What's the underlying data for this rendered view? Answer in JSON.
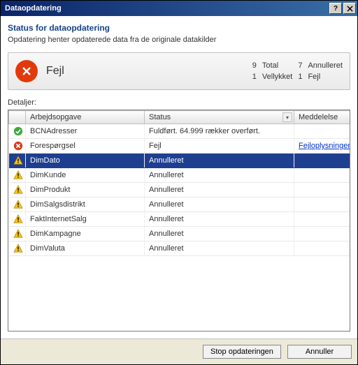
{
  "window": {
    "title": "Dataopdatering"
  },
  "header": {
    "title": "Status for dataopdatering",
    "subtitle": "Opdatering henter opdaterede data fra de originale datakilder"
  },
  "overall": {
    "status_text": "Fejl",
    "total_count": "9",
    "total_label": "Total",
    "cancelled_count": "7",
    "cancelled_label": "Annulleret",
    "success_count": "1",
    "success_label": "Vellykket",
    "error_count": "1",
    "error_label": "Fejl"
  },
  "details_label": "Detaljer:",
  "columns": {
    "icon": "",
    "work_item": "Arbejdsopgave",
    "status": "Status",
    "message": "Meddelelse"
  },
  "rows": [
    {
      "icon": "success",
      "name": "BCNAdresser",
      "status": "Fuldført. 64.999 rækker overført.",
      "message": "",
      "selected": false
    },
    {
      "icon": "error",
      "name": "Forespørgsel",
      "status": "Fejl",
      "message": "Fejloplysninger",
      "msg_link": true,
      "selected": false
    },
    {
      "icon": "warning",
      "name": "DimDato",
      "status": "Annulleret",
      "message": "",
      "selected": true
    },
    {
      "icon": "warning",
      "name": "DimKunde",
      "status": "Annulleret",
      "message": "",
      "selected": false
    },
    {
      "icon": "warning",
      "name": "DimProdukt",
      "status": "Annulleret",
      "message": "",
      "selected": false
    },
    {
      "icon": "warning",
      "name": "DimSalgsdistrikt",
      "status": "Annulleret",
      "message": "",
      "selected": false
    },
    {
      "icon": "warning",
      "name": "FaktInternetSalg",
      "status": "Annulleret",
      "message": "",
      "selected": false
    },
    {
      "icon": "warning",
      "name": "DimKampagne",
      "status": "Annulleret",
      "message": "",
      "selected": false
    },
    {
      "icon": "warning",
      "name": "DimValuta",
      "status": "Annulleret",
      "message": "",
      "selected": false
    }
  ],
  "buttons": {
    "stop": "Stop opdateringen",
    "cancel": "Annuller"
  }
}
